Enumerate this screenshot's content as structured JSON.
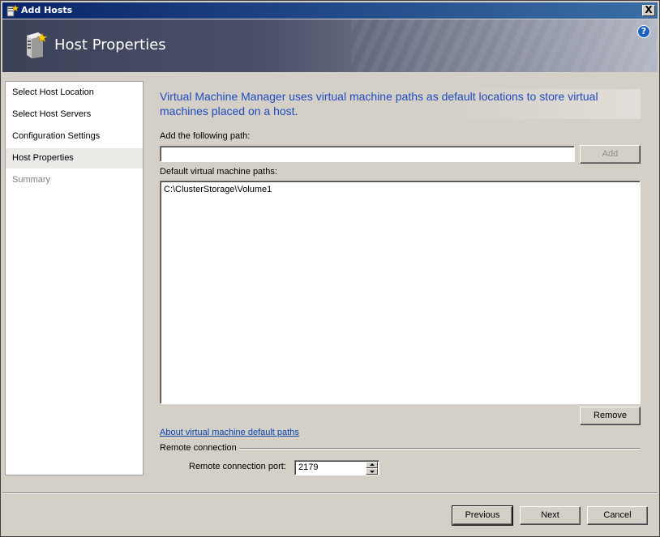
{
  "window": {
    "title": "Add Hosts",
    "close_glyph": "X",
    "app_icon": "wizard-star-icon"
  },
  "header": {
    "title": "Host Properties",
    "icon": "server-icon",
    "help_glyph": "?"
  },
  "steps": [
    {
      "label": "Select Host Location",
      "state": "normal"
    },
    {
      "label": "Select Host Servers",
      "state": "normal"
    },
    {
      "label": "Configuration Settings",
      "state": "normal"
    },
    {
      "label": "Host Properties",
      "state": "active"
    },
    {
      "label": "Summary",
      "state": "disabled"
    }
  ],
  "main": {
    "intro": "Virtual Machine Manager uses virtual machine paths as default locations to store virtual machines placed on a host.",
    "add_path_label": "Add the following path:",
    "add_path_value": "",
    "add_button": "Add",
    "default_paths_label": "Default virtual machine paths:",
    "default_paths": [
      "C:\\ClusterStorage\\Volume1"
    ],
    "remove_button": "Remove",
    "about_link": "About virtual machine default paths",
    "remote_group": "Remote connection",
    "remote_port_label": "Remote connection port:",
    "remote_port_value": "2179"
  },
  "footer": {
    "previous": "Previous",
    "next": "Next",
    "cancel": "Cancel"
  },
  "colors": {
    "intro_text": "#1f4bbf",
    "link": "#0645ad",
    "dialog_bg": "#d4d0c8",
    "titlebar": "#0a246a"
  }
}
